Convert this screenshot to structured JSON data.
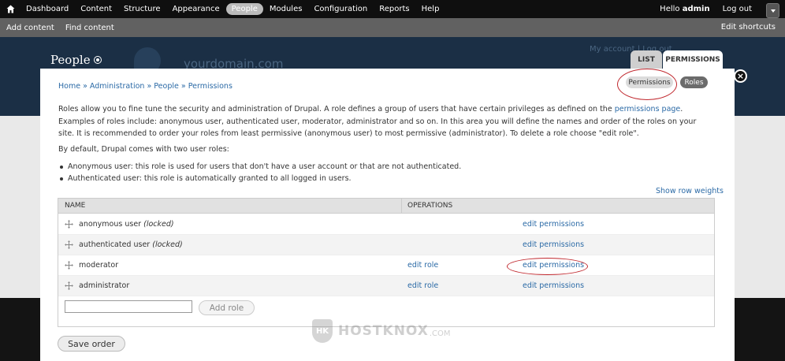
{
  "toolbar": {
    "menu": [
      "Dashboard",
      "Content",
      "Structure",
      "Appearance",
      "People",
      "Modules",
      "Configuration",
      "Reports",
      "Help"
    ],
    "active": "People",
    "hello_prefix": "Hello ",
    "user": "admin",
    "logout": "Log out"
  },
  "shortcuts": {
    "items": [
      "Add content",
      "Find content"
    ],
    "edit": "Edit shortcuts"
  },
  "header": {
    "page_title": "People",
    "site_name": "yourdomain.com",
    "my_account": "My account | Log out",
    "tabs": [
      "LIST",
      "PERMISSIONS"
    ]
  },
  "dialog": {
    "breadcrumb": [
      "Home",
      "Administration",
      "People",
      "Permissions"
    ],
    "breadcrumb_sep": " » ",
    "secondary_tabs": [
      "Permissions",
      "Roles"
    ],
    "intro_part1": "Roles allow you to fine tune the security and administration of Drupal. A role defines a group of users that have certain privileges as defined on the ",
    "intro_link": "permissions page",
    "intro_part2": ". Examples of roles include: anonymous user, authenticated user, moderator, administrator and so on. In this area you will define the names and order of the roles on your site. It is recommended to order your roles from least permissive (anonymous user) to most permissive (administrator). To delete a role choose \"edit role\".",
    "default_roles": "By default, Drupal comes with two user roles:",
    "role_descriptions": [
      "Anonymous user: this role is used for users that don't have a user account or that are not authenticated.",
      "Authenticated user: this role is automatically granted to all logged in users."
    ],
    "show_row_weights": "Show row weights",
    "table": {
      "headers": [
        "NAME",
        "OPERATIONS"
      ],
      "rows": [
        {
          "name": "anonymous user",
          "locked": "(locked)",
          "edit_role": "",
          "edit_permissions": "edit permissions"
        },
        {
          "name": "authenticated user",
          "locked": "(locked)",
          "edit_role": "",
          "edit_permissions": "edit permissions"
        },
        {
          "name": "moderator",
          "locked": "",
          "edit_role": "edit role",
          "edit_permissions": "edit permissions"
        },
        {
          "name": "administrator",
          "locked": "",
          "edit_role": "edit role",
          "edit_permissions": "edit permissions"
        }
      ]
    },
    "new_role_value": "",
    "add_role": "Add role",
    "save_order": "Save order"
  },
  "watermark": {
    "text": "HOSTKNOX",
    "domain": ".COM"
  },
  "colors": {
    "link": "#2b6aa6",
    "annotation": "#c0272d",
    "toolbar": "#0f0f0f",
    "header": "#1b2f45"
  }
}
